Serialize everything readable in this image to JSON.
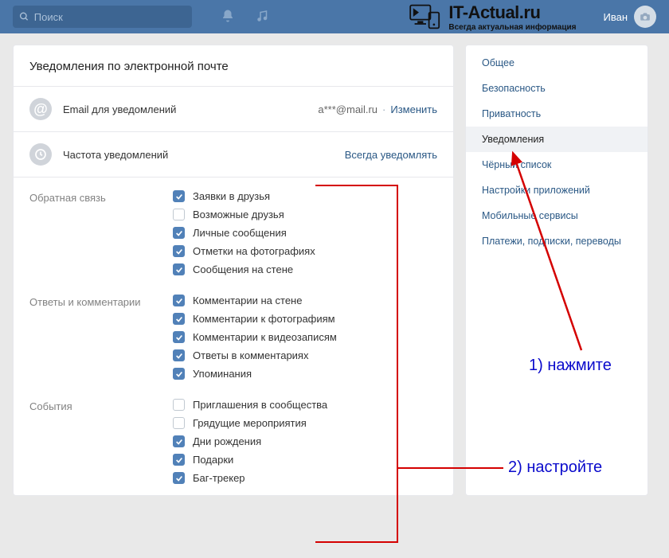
{
  "topbar": {
    "search_placeholder": "Поиск",
    "user_name": "Иван",
    "logo_title": "IT-Actual.ru",
    "logo_subtitle": "Всегда актуальная информация"
  },
  "main": {
    "title": "Уведомления по электронной почте",
    "email_label": "Email для уведомлений",
    "email_value": "a***@mail.ru",
    "change_link": "Изменить",
    "freq_label": "Частота уведомлений",
    "freq_value": "Всегда уведомлять"
  },
  "groups": [
    {
      "label": "Обратная связь",
      "items": [
        {
          "label": "Заявки в друзья",
          "checked": true
        },
        {
          "label": "Возможные друзья",
          "checked": false
        },
        {
          "label": "Личные сообщения",
          "checked": true
        },
        {
          "label": "Отметки на фотографиях",
          "checked": true
        },
        {
          "label": "Сообщения на стене",
          "checked": true
        }
      ]
    },
    {
      "label": "Ответы и комментарии",
      "items": [
        {
          "label": "Комментарии на стене",
          "checked": true
        },
        {
          "label": "Комментарии к фотографиям",
          "checked": true
        },
        {
          "label": "Комментарии к видеозаписям",
          "checked": true
        },
        {
          "label": "Ответы в комментариях",
          "checked": true
        },
        {
          "label": "Упоминания",
          "checked": true
        }
      ]
    },
    {
      "label": "События",
      "items": [
        {
          "label": "Приглашения в сообщества",
          "checked": false
        },
        {
          "label": "Грядущие мероприятия",
          "checked": false
        },
        {
          "label": "Дни рождения",
          "checked": true
        },
        {
          "label": "Подарки",
          "checked": true
        },
        {
          "label": "Баг-трекер",
          "checked": true
        }
      ]
    }
  ],
  "sidebar": {
    "items": [
      "Общее",
      "Безопасность",
      "Приватность",
      "Уведомления",
      "Чёрный список",
      "Настройки приложений",
      "Мобильные сервисы",
      "Платежи, подписки, переводы"
    ],
    "active_index": 3
  },
  "annotations": {
    "step1": "1) нажмите",
    "step2": "2) настройте"
  }
}
